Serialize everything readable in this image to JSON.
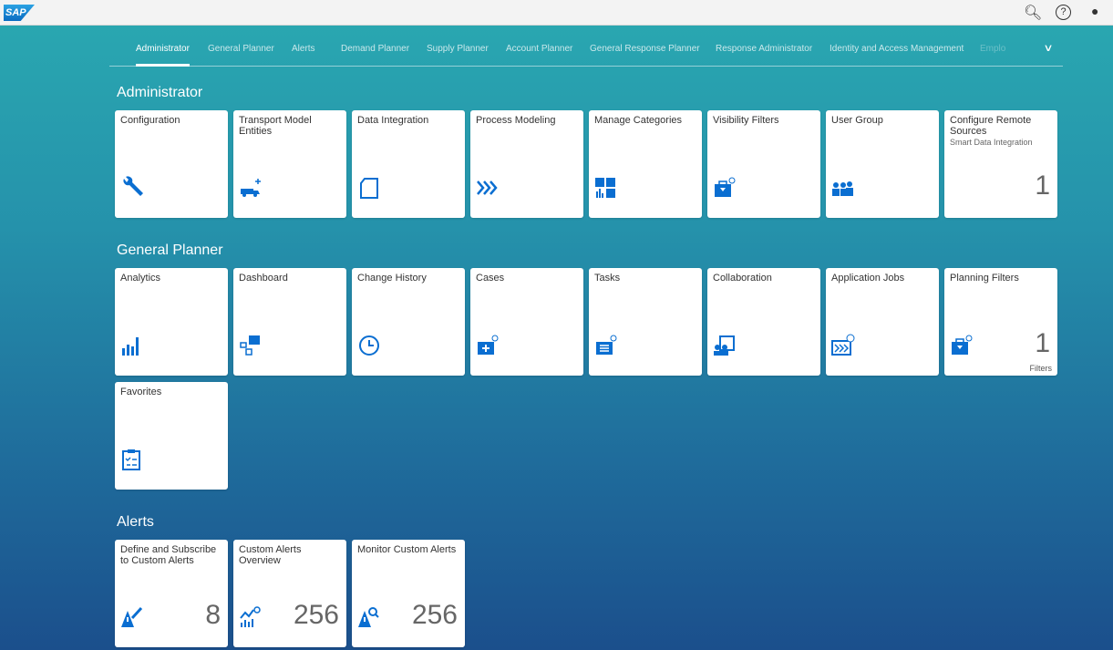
{
  "shell": {
    "logo": "SAP",
    "icons": [
      "search-icon",
      "help-icon",
      "user-icon"
    ]
  },
  "tabs": [
    "Administrator",
    "General Planner",
    "Alerts",
    "Demand Planner",
    "Supply Planner",
    "Account Planner",
    "General Response Planner",
    "Response Administrator",
    "Identity and Access Management",
    "Emplo"
  ],
  "active_tab": "Administrator",
  "sections": [
    {
      "title": "Administrator",
      "tiles": [
        {
          "title": "Configuration",
          "icon": "wrench-icon"
        },
        {
          "title": "Transport Model Entities",
          "icon": "truck-add-icon"
        },
        {
          "title": "Data Integration",
          "icon": "document-icon"
        },
        {
          "title": "Process Modeling",
          "icon": "process-icon"
        },
        {
          "title": "Manage Categories",
          "icon": "categories-icon"
        },
        {
          "title": "Visibility Filters",
          "icon": "filter-briefcase-icon"
        },
        {
          "title": "User Group",
          "icon": "user-group-icon"
        },
        {
          "title": "Configure Remote Sources",
          "subtitle": "Smart Data Integration",
          "number": "1",
          "icon": ""
        }
      ]
    },
    {
      "title": "General Planner",
      "tiles": [
        {
          "title": "Analytics",
          "icon": "bar-chart-icon"
        },
        {
          "title": "Dashboard",
          "icon": "dashboard-icon"
        },
        {
          "title": "Change History",
          "icon": "clock-icon"
        },
        {
          "title": "Cases",
          "icon": "cases-icon"
        },
        {
          "title": "Tasks",
          "icon": "tasks-icon"
        },
        {
          "title": "Collaboration",
          "icon": "collaboration-icon"
        },
        {
          "title": "Application Jobs",
          "icon": "jobs-icon"
        },
        {
          "title": "Planning Filters",
          "number": "1",
          "unit": "Filters",
          "icon": "filter-briefcase-icon"
        },
        {
          "title": "Favorites",
          "icon": "clipboard-icon"
        }
      ]
    },
    {
      "title": "Alerts",
      "tiles": [
        {
          "title": "Define and Subscribe to Custom Alerts",
          "number": "8",
          "icon": "alert-edit-icon"
        },
        {
          "title": "Custom Alerts Overview",
          "number": "256",
          "icon": "alert-chart-icon"
        },
        {
          "title": "Monitor Custom Alerts",
          "number": "256",
          "icon": "alert-search-icon"
        }
      ]
    }
  ],
  "colors": {
    "accent": "#0a6ed1",
    "bg_top": "#2aa9b1",
    "bg_bottom": "#1b4f8c"
  }
}
